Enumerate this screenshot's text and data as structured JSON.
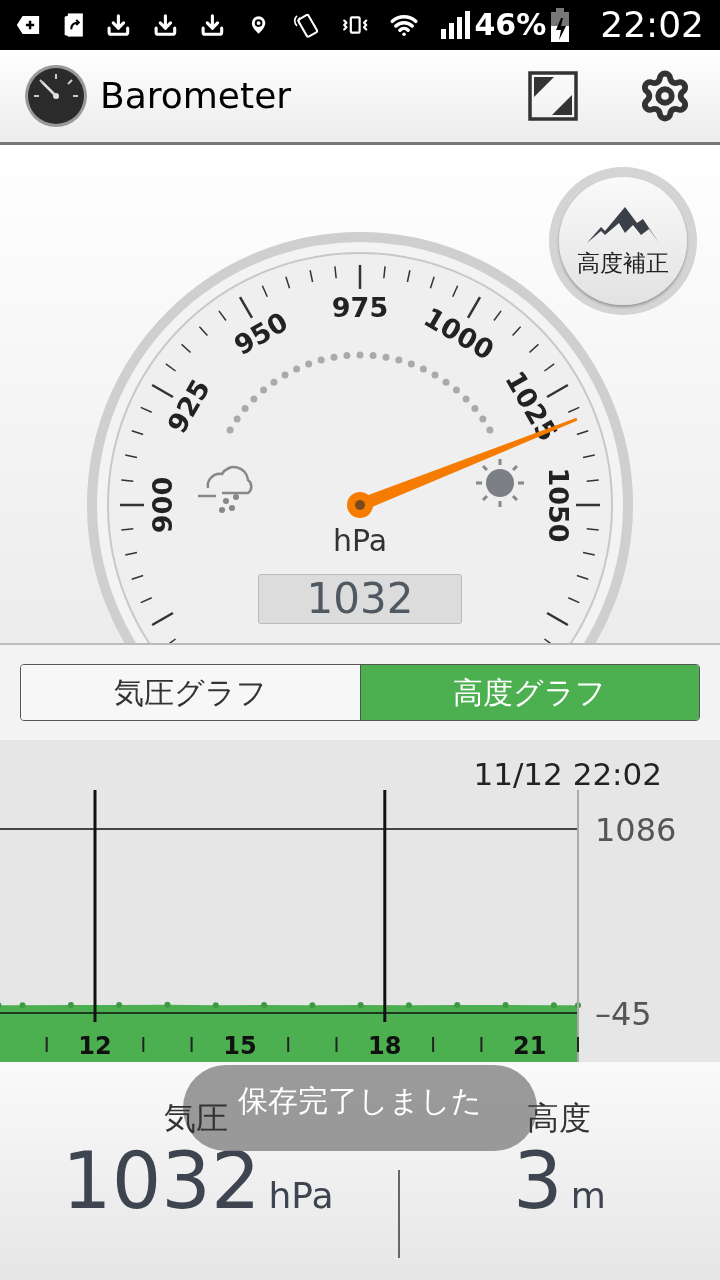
{
  "status_bar": {
    "battery": "46%",
    "time": "22:02"
  },
  "app_bar": {
    "title": "Barometer"
  },
  "gauge": {
    "scale_labels": [
      "900",
      "925",
      "950",
      "975",
      "1000",
      "1025",
      "1050"
    ],
    "unit": "hPa",
    "reading": "1032"
  },
  "altitude_button": {
    "label": "高度補正"
  },
  "tabs": [
    {
      "label": "気圧グラフ",
      "selected": false
    },
    {
      "label": "高度グラフ",
      "selected": true
    }
  ],
  "graph": {
    "timestamp": "11/12 22:02",
    "chart_data": {
      "type": "area",
      "x": [
        10,
        10.5,
        11.5,
        12.5,
        13.5,
        14.5,
        15.5,
        16.5,
        17.5,
        18.5,
        19.5,
        20.5,
        21.5,
        22
      ],
      "series": [
        {
          "color": "#4caf50",
          "values": [
            3,
            3,
            4,
            4,
            5,
            3,
            4,
            3,
            4,
            3,
            4,
            4,
            3,
            3
          ]
        }
      ],
      "xlim": [
        10,
        22
      ],
      "ylim": [
        -45,
        1086
      ],
      "xticks": [
        12,
        15,
        18,
        21
      ],
      "yticks": [
        1086,
        {
          "value": -45,
          "label": "–45"
        }
      ]
    }
  },
  "summary": [
    {
      "label": "気圧",
      "value": "1032",
      "unit": "hPa"
    },
    {
      "label": "高度",
      "value": "3",
      "unit": "m"
    }
  ],
  "toast": {
    "message": "保存完了しました"
  }
}
